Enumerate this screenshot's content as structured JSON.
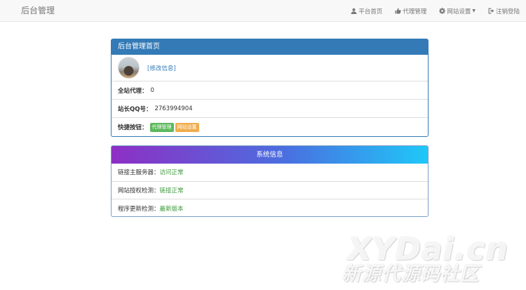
{
  "navbar": {
    "brand": "后台管理",
    "items": [
      {
        "label": "平台首页",
        "icon": "user-icon"
      },
      {
        "label": "代理管理",
        "icon": "thumbs-up-icon"
      },
      {
        "label": "网站设置",
        "icon": "gear-icon",
        "dropdown": true
      },
      {
        "label": "注销登陆",
        "icon": "sign-out-icon"
      }
    ]
  },
  "main_panel": {
    "title": "后台管理首页",
    "edit_link": "[修改信息]",
    "rows": [
      {
        "label": "全站代理：",
        "value": "0"
      },
      {
        "label": "站长QQ号：",
        "value": "2763994904"
      }
    ],
    "shortcuts": {
      "label": "快捷按钮：",
      "buttons": [
        {
          "label": "代理管理",
          "color": "#5cb85c"
        },
        {
          "label": "网站设置",
          "color": "#f0ad4e"
        }
      ]
    }
  },
  "info_panel": {
    "title": "系统信息",
    "rows": [
      {
        "label": "链接主服务器：",
        "value": "访问正常"
      },
      {
        "label": "网站授权检测：",
        "value": "链接正常"
      },
      {
        "label": "程序更新检测：",
        "value": "最新版本"
      }
    ]
  },
  "watermark": {
    "line1": "XYDai.cn",
    "line2": "新源代源码社区"
  },
  "colors": {
    "primary": "#337ab7",
    "success": "#5cb85c",
    "warning": "#f0ad4e",
    "ok_text": "#3c9a3c",
    "gradient_start": "#8e2fc4",
    "gradient_end": "#1fc8f8"
  }
}
